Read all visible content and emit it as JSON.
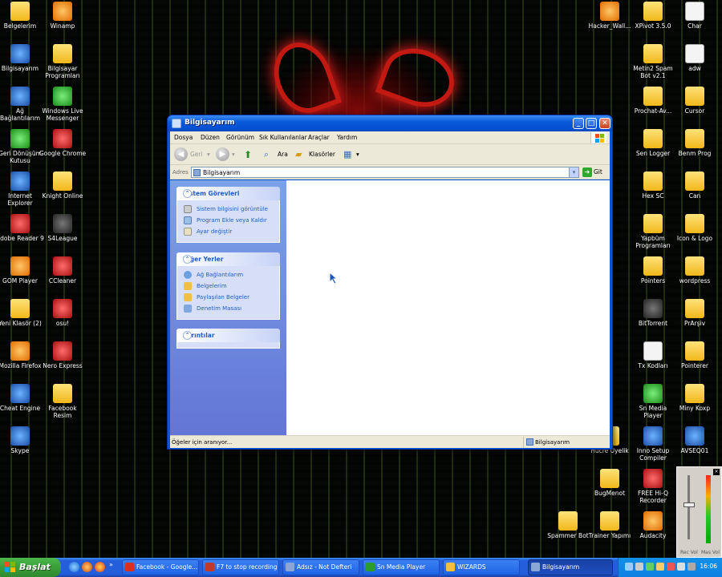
{
  "desktop": {
    "left_icons": [
      {
        "name": "desktop-icon-belgelerim",
        "label": "Belgelerim",
        "icon": "folder-docs-icon",
        "kind": "folder"
      },
      {
        "name": "desktop-icon-winamp",
        "label": "Winamp",
        "icon": "winamp-icon",
        "kind": "orange"
      },
      {
        "name": "desktop-icon-bilgisayarim",
        "label": "Bilgisayarım",
        "icon": "computer-icon",
        "kind": "app"
      },
      {
        "name": "desktop-icon-bilgisayar-programlari",
        "label": "Bilgisayar Programları",
        "icon": "folder-icon",
        "kind": "folder"
      },
      {
        "name": "desktop-icon-ag-baglantilarim",
        "label": "Ağ Bağlantılarım",
        "icon": "network-icon",
        "kind": "app"
      },
      {
        "name": "desktop-icon-windows-live-messenger",
        "label": "Windows Live Messenger",
        "icon": "messenger-icon",
        "kind": "green"
      },
      {
        "name": "desktop-icon-geri-donusum",
        "label": "Geri Dönüşüm Kutusu",
        "icon": "recycle-bin-icon",
        "kind": "green"
      },
      {
        "name": "desktop-icon-google-chrome",
        "label": "Google Chrome",
        "icon": "chrome-icon",
        "kind": "red"
      },
      {
        "name": "desktop-icon-internet-explorer",
        "label": "Internet Explorer",
        "icon": "ie-icon",
        "kind": "app"
      },
      {
        "name": "desktop-icon-knight-online",
        "label": "Knight Online",
        "icon": "folder-icon",
        "kind": "folder"
      },
      {
        "name": "desktop-icon-adobe-reader",
        "label": "Adobe Reader 9",
        "icon": "adobe-reader-icon",
        "kind": "red"
      },
      {
        "name": "desktop-icon-s4league",
        "label": "S4League",
        "icon": "s4league-icon",
        "kind": "dark"
      },
      {
        "name": "desktop-icon-gom-player",
        "label": "GOM Player",
        "icon": "gom-player-icon",
        "kind": "orange"
      },
      {
        "name": "desktop-icon-ccleaner",
        "label": "CCleaner",
        "icon": "ccleaner-icon",
        "kind": "red"
      },
      {
        "name": "desktop-icon-yeni-klasor",
        "label": "Yeni Klasör (2)",
        "icon": "folder-icon",
        "kind": "folder"
      },
      {
        "name": "desktop-icon-osu",
        "label": "osu!",
        "icon": "osu-icon",
        "kind": "red"
      },
      {
        "name": "desktop-icon-mozilla-firefox",
        "label": "Mozilla Firefox",
        "icon": "firefox-icon",
        "kind": "orange"
      },
      {
        "name": "desktop-icon-nero-express",
        "label": "Nero Express",
        "icon": "nero-icon",
        "kind": "red"
      },
      {
        "name": "desktop-icon-cheat-engine",
        "label": "Cheat Engine",
        "icon": "cheat-engine-icon",
        "kind": "app"
      },
      {
        "name": "desktop-icon-facebook-resim",
        "label": "Facebook Resim",
        "icon": "folder-icon",
        "kind": "folder"
      },
      {
        "name": "desktop-icon-skype",
        "label": "Skype",
        "icon": "skype-icon",
        "kind": "app"
      }
    ],
    "right_icons": [
      {
        "name": "desktop-icon-hacker-wall",
        "label": "Hacker_Wall...",
        "icon": "image-file-icon",
        "kind": "orange"
      },
      {
        "name": "desktop-icon-xpivot",
        "label": "XPivot 3.5.0",
        "icon": "folder-icon",
        "kind": "folder"
      },
      {
        "name": "desktop-icon-char",
        "label": "Char",
        "icon": "text-file-icon",
        "kind": "doc"
      },
      {
        "name": "desktop-icon-metin2",
        "label": "Metin2 Spam Bot v2.1",
        "icon": "folder-icon",
        "kind": "folder"
      },
      {
        "name": "desktop-icon-adw",
        "label": "adw",
        "icon": "text-file-icon",
        "kind": "doc"
      },
      {
        "name": "desktop-icon-prochat",
        "label": "Prochat-Av...",
        "icon": "folder-icon",
        "kind": "folder"
      },
      {
        "name": "desktop-icon-cursor",
        "label": "Cursor",
        "icon": "folder-icon",
        "kind": "folder"
      },
      {
        "name": "desktop-icon-sen-logger",
        "label": "Sen Logger",
        "icon": "folder-icon",
        "kind": "folder"
      },
      {
        "name": "desktop-icon-benim-prog",
        "label": "Benm Prog",
        "icon": "folder-icon",
        "kind": "folder"
      },
      {
        "name": "desktop-icon-hex-sc",
        "label": "Hex SC",
        "icon": "folder-icon",
        "kind": "folder"
      },
      {
        "name": "desktop-icon-can",
        "label": "Can",
        "icon": "folder-icon",
        "kind": "folder"
      },
      {
        "name": "desktop-icon-yapbum",
        "label": "Yapbüm Programları",
        "icon": "folder-icon",
        "kind": "folder"
      },
      {
        "name": "desktop-icon-icon-logo",
        "label": "Icon & Logo",
        "icon": "folder-icon",
        "kind": "folder"
      },
      {
        "name": "desktop-icon-pointers",
        "label": "Pointers",
        "icon": "folder-icon",
        "kind": "folder"
      },
      {
        "name": "desktop-icon-wordpress",
        "label": "wordpress",
        "icon": "folder-icon",
        "kind": "folder"
      },
      {
        "name": "desktop-icon-bittorrent",
        "label": "BitTorrent",
        "icon": "bittorrent-icon",
        "kind": "dark"
      },
      {
        "name": "desktop-icon-prarsiv",
        "label": "PrArşiv",
        "icon": "folder-icon",
        "kind": "folder"
      },
      {
        "name": "desktop-icon-tx-kodlari",
        "label": "Tx Kodları",
        "icon": "text-file-icon",
        "kind": "doc"
      },
      {
        "name": "desktop-icon-pointerer",
        "label": "Pointerer",
        "icon": "folder-icon",
        "kind": "folder"
      },
      {
        "name": "desktop-icon-sn-media-player",
        "label": "Sn Media Player",
        "icon": "media-player-icon",
        "kind": "green"
      },
      {
        "name": "desktop-icon-miny-koxp",
        "label": "Miny Koxp",
        "icon": "folder-icon",
        "kind": "folder"
      },
      {
        "name": "desktop-icon-hucre-uyelik",
        "label": "Hücre Üyelik",
        "icon": "folder-icon",
        "kind": "folder"
      },
      {
        "name": "desktop-icon-inno-setup",
        "label": "Inno Setup Compiler",
        "icon": "inno-setup-icon",
        "kind": "app"
      },
      {
        "name": "desktop-icon-avseq01",
        "label": "AVSEQ01",
        "icon": "video-file-icon",
        "kind": "app"
      },
      {
        "name": "desktop-icon-bugmenot",
        "label": "BugMenot",
        "icon": "folder-icon",
        "kind": "folder"
      },
      {
        "name": "desktop-icon-free-hq-recorder",
        "label": "FREE Hi-Q Recorder",
        "icon": "recorder-icon",
        "kind": "red"
      },
      {
        "name": "desktop-icon-spammer-bot",
        "label": "Spammer Bot",
        "icon": "folder-icon",
        "kind": "folder"
      },
      {
        "name": "desktop-icon-trainer-yapimi",
        "label": "Trainer Yapımı",
        "icon": "folder-icon",
        "kind": "folder"
      },
      {
        "name": "desktop-icon-audacity",
        "label": "Audacity",
        "icon": "audacity-icon",
        "kind": "orange"
      }
    ]
  },
  "window": {
    "title": "Bilgisayarım",
    "menu": [
      "Dosya",
      "Düzen",
      "Görünüm",
      "Sık Kullanılanlar",
      "Araçlar",
      "Yardım"
    ],
    "toolbar": {
      "back_label": "Geri",
      "search_label": "Ara",
      "folders_label": "Klasörler"
    },
    "address": {
      "label": "Adres",
      "value": "Bilgisayarım",
      "go_label": "Git"
    },
    "panels": {
      "system_tasks": {
        "title": "Sistem Görevleri",
        "items": [
          "Sistem bilgisini görüntüle",
          "Program Ekle veya Kaldır",
          "Ayar değiştir"
        ]
      },
      "other_places": {
        "title": "Diğer Yerler",
        "items": [
          "Ağ Bağlantılarım",
          "Belgelerim",
          "Paylaşılan Belgeler",
          "Denetim Masası"
        ]
      },
      "details": {
        "title": "Ayrıntılar"
      }
    },
    "status": {
      "left": "Öğeler için aranıyor...",
      "right": "Bilgisayarım"
    }
  },
  "mixer": {
    "labels": [
      "Rec Vol",
      "Mas Vol"
    ]
  },
  "taskbar": {
    "start_label": "Başlat",
    "items": [
      {
        "label": "Facebook - Google...",
        "icon": "chrome-icon",
        "active": false
      },
      {
        "label": "F7 to stop recording",
        "icon": "recorder-icon",
        "active": false
      },
      {
        "label": "Adsız - Not Defteri",
        "icon": "notepad-icon",
        "active": false
      },
      {
        "label": "Sn Media Player",
        "icon": "media-player-icon",
        "active": false
      },
      {
        "label": "WIZARDS",
        "icon": "folder-icon",
        "active": false
      },
      {
        "label": "Bilgisayarım",
        "icon": "computer-icon",
        "active": true
      }
    ],
    "clock": "16:06"
  },
  "colors": {
    "xp_blue": "#0a56d8",
    "task_link": "#215dc6",
    "start_green": "#3a9e3a"
  }
}
